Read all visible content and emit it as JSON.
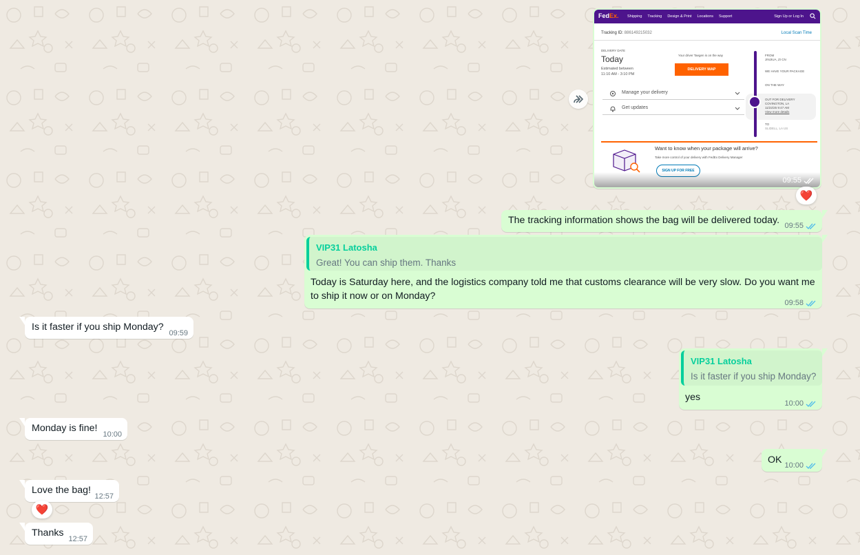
{
  "screenshot": {
    "brand_fed": "Fed",
    "brand_ex": "Ex.",
    "nav_items": [
      "Shipping",
      "Tracking",
      "Design & Print",
      "Locations",
      "Support"
    ],
    "sign_in": "Sign Up or Log In",
    "tracking_id_label": "Tracking ID:",
    "tracking_id": "886149215032",
    "local_scan_time": "Local Scan Time",
    "delivery_date_label": "DELIVERY DATE",
    "delivery_day": "Today",
    "estimated_between": "Estimated between",
    "estimated_window": "11:10 AM - 3:10 PM",
    "driver_text": "Your driver Taegen is on the way",
    "delivery_map_button": "DELIVERY MAP",
    "manage_delivery": "Manage your delivery",
    "get_updates": "Get updates",
    "from_label": "FROM",
    "from_city": "JINJIUA, ZI CN",
    "we_have": "WE HAVE YOUR PACKAGE",
    "on_the_way": "ON THE WAY",
    "out_for_delivery": "OUT FOR DELIVERY",
    "out_location": "COVINGTON, LA",
    "out_time": "11/22/25 9:47 AM",
    "view_more": "View more details",
    "to_label": "TO",
    "to_city": "SLIDELL, LA US",
    "want_know": "Want to know when your package will arrive?",
    "take_control": "Take more control of your delivery with FedEx Delivery Manager",
    "sign_up_free": "SIGN UP FOR FREE",
    "time": "09:55",
    "reaction": "❤️"
  },
  "messages": [
    {
      "id": "m1",
      "direction": "out",
      "text": "The tracking information shows the bag will be delivered today.",
      "time": "09:55"
    },
    {
      "id": "m2",
      "direction": "out",
      "quote_author": "VIP31 Latosha",
      "quote_text": "Great! You can ship them. Thanks",
      "text_line1": "Today is Saturday here, and the logistics company told me that customs clearance will be very slow. Do you want me",
      "text_line2": "to ship it now or on Monday?",
      "time": "09:58"
    },
    {
      "id": "m3",
      "direction": "in",
      "text": "Is it faster if you ship Monday?",
      "time": "09:59"
    },
    {
      "id": "m4",
      "direction": "out",
      "quote_author": "VIP31 Latosha",
      "quote_text": "Is it faster if you ship Monday?",
      "text": "yes",
      "time": "10:00"
    },
    {
      "id": "m5",
      "direction": "in",
      "text": "Monday is fine!",
      "time": "10:00"
    },
    {
      "id": "m6",
      "direction": "out",
      "text": "OK",
      "time": "10:00"
    },
    {
      "id": "m7",
      "direction": "in",
      "text": "Love the bag!",
      "time": "12:57",
      "reaction": "❤️"
    },
    {
      "id": "m8",
      "direction": "in",
      "text": "Thanks",
      "time": "12:57"
    }
  ],
  "colors": {
    "outgoing_bubble": "#d9fdd3",
    "incoming_bubble": "#ffffff",
    "quote_accent": "#06cf9c",
    "read_ticks": "#53bdeb",
    "chat_background": "#efeae2",
    "fedex_purple": "#4d148c",
    "fedex_orange": "#ff6200"
  },
  "icons": [
    "forward-icon",
    "double-check-icon",
    "heart-icon",
    "search-icon",
    "user-icon",
    "chevron-down-icon",
    "gear-icon",
    "bell-icon",
    "package-icon"
  ]
}
